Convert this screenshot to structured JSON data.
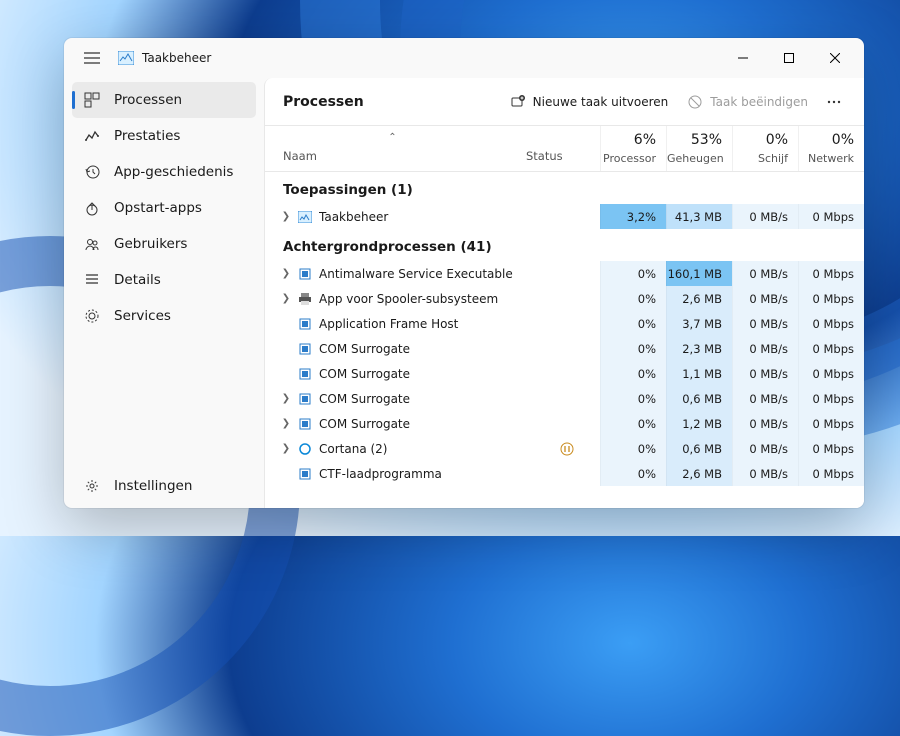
{
  "app": {
    "title": "Taakbeheer"
  },
  "sidebar": {
    "items": [
      {
        "label": "Processen",
        "icon": "processes-icon",
        "active": true
      },
      {
        "label": "Prestaties",
        "icon": "performance-icon"
      },
      {
        "label": "App-geschiedenis",
        "icon": "history-icon"
      },
      {
        "label": "Opstart-apps",
        "icon": "startup-icon"
      },
      {
        "label": "Gebruikers",
        "icon": "users-icon"
      },
      {
        "label": "Details",
        "icon": "details-icon"
      },
      {
        "label": "Services",
        "icon": "services-icon"
      }
    ],
    "settings": {
      "label": "Instellingen",
      "icon": "settings-icon"
    }
  },
  "toolbar": {
    "title": "Processen",
    "new_task": "Nieuwe taak uitvoeren",
    "end_task": "Taak beëindigen"
  },
  "columns": {
    "name": "Naam",
    "status": "Status",
    "cpu": {
      "pct": "6%",
      "label": "Processor"
    },
    "mem": {
      "pct": "53%",
      "label": "Geheugen"
    },
    "disk": {
      "pct": "0%",
      "label": "Schijf"
    },
    "net": {
      "pct": "0%",
      "label": "Netwerk"
    }
  },
  "groups": [
    {
      "title": "Toepassingen (1)",
      "rows": [
        {
          "expand": true,
          "icon": "taskmgr",
          "name": "Taakbeheer",
          "cpu": "3,2%",
          "cpuH": "h-high",
          "mem": "41,3 MB",
          "memH": "h-mid",
          "disk": "0 MB/s",
          "net": "0 Mbps"
        }
      ]
    },
    {
      "title": "Achtergrondprocessen (41)",
      "rows": [
        {
          "expand": true,
          "icon": "box",
          "name": "Antimalware Service Executable",
          "cpu": "0%",
          "cpuH": "h-low",
          "mem": "160,1 MB",
          "memH": "h-high",
          "disk": "0 MB/s",
          "net": "0 Mbps"
        },
        {
          "expand": true,
          "icon": "printer",
          "name": "App voor Spooler-subsysteem",
          "cpu": "0%",
          "cpuH": "h-low",
          "mem": "2,6 MB",
          "memH": "h-low2",
          "disk": "0 MB/s",
          "net": "0 Mbps"
        },
        {
          "expand": false,
          "icon": "box",
          "name": "Application Frame Host",
          "cpu": "0%",
          "cpuH": "h-low",
          "mem": "3,7 MB",
          "memH": "h-low2",
          "disk": "0 MB/s",
          "net": "0 Mbps"
        },
        {
          "expand": false,
          "icon": "box",
          "name": "COM Surrogate",
          "cpu": "0%",
          "cpuH": "h-low",
          "mem": "2,3 MB",
          "memH": "h-low2",
          "disk": "0 MB/s",
          "net": "0 Mbps"
        },
        {
          "expand": false,
          "icon": "box",
          "name": "COM Surrogate",
          "cpu": "0%",
          "cpuH": "h-low",
          "mem": "1,1 MB",
          "memH": "h-low2",
          "disk": "0 MB/s",
          "net": "0 Mbps"
        },
        {
          "expand": true,
          "icon": "box",
          "name": "COM Surrogate",
          "cpu": "0%",
          "cpuH": "h-low",
          "mem": "0,6 MB",
          "memH": "h-low2",
          "disk": "0 MB/s",
          "net": "0 Mbps"
        },
        {
          "expand": true,
          "icon": "box",
          "name": "COM Surrogate",
          "cpu": "0%",
          "cpuH": "h-low",
          "mem": "1,2 MB",
          "memH": "h-low2",
          "disk": "0 MB/s",
          "net": "0 Mbps"
        },
        {
          "expand": true,
          "icon": "cortana",
          "name": "Cortana (2)",
          "status": "paused",
          "cpu": "0%",
          "cpuH": "h-low",
          "mem": "0,6 MB",
          "memH": "h-low2",
          "disk": "0 MB/s",
          "net": "0 Mbps"
        },
        {
          "expand": false,
          "icon": "box",
          "name": "CTF-laadprogramma",
          "cpu": "0%",
          "cpuH": "h-low",
          "mem": "2,6 MB",
          "memH": "h-low2",
          "disk": "0 MB/s",
          "net": "0 Mbps"
        }
      ]
    }
  ]
}
